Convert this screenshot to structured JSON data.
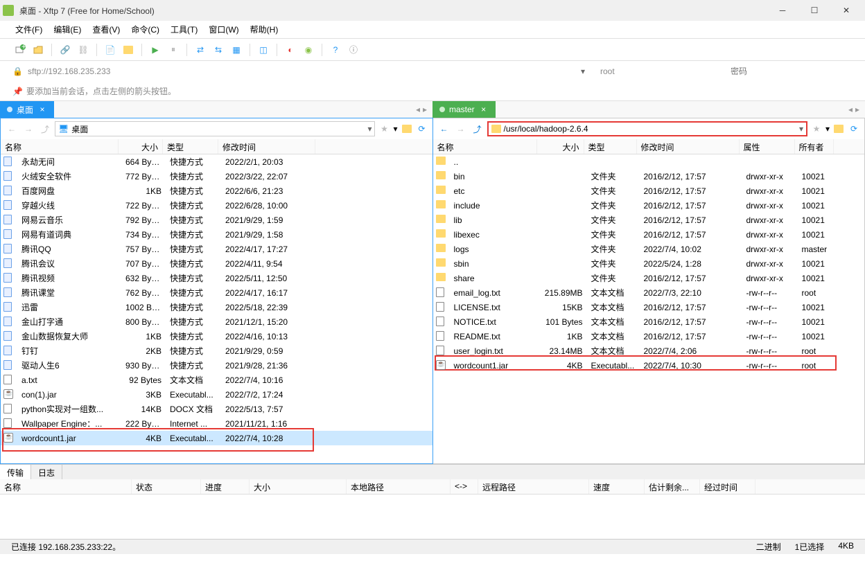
{
  "window": {
    "title": "桌面 - Xftp 7 (Free for Home/School)"
  },
  "menu": {
    "file": "文件(F)",
    "edit": "编辑(E)",
    "view": "查看(V)",
    "cmd": "命令(C)",
    "tool": "工具(T)",
    "window": "窗口(W)",
    "help": "帮助(H)"
  },
  "address": {
    "url": "sftp://192.168.235.233",
    "user": "root",
    "pass_placeholder": "密码"
  },
  "hint": "要添加当前会话，点击左侧的箭头按钮。",
  "leftTab": {
    "title": "桌面"
  },
  "rightTab": {
    "title": "master"
  },
  "leftPath": {
    "label": "桌面"
  },
  "rightPath": {
    "value": "/usr/local/hadoop-2.6.4"
  },
  "leftCols": {
    "name": "名称",
    "size": "大小",
    "type": "类型",
    "time": "修改时间"
  },
  "rightCols": {
    "name": "名称",
    "size": "大小",
    "type": "类型",
    "time": "修改时间",
    "attr": "属性",
    "owner": "所有者"
  },
  "leftFiles": [
    {
      "name": "永劫无间",
      "size": "664 Bytes",
      "type": "快捷方式",
      "time": "2022/2/1, 20:03",
      "icon": "app"
    },
    {
      "name": "火绒安全软件",
      "size": "772 Bytes",
      "type": "快捷方式",
      "time": "2022/3/22, 22:07",
      "icon": "app"
    },
    {
      "name": "百度网盘",
      "size": "1KB",
      "type": "快捷方式",
      "time": "2022/6/6, 21:23",
      "icon": "app"
    },
    {
      "name": "穿越火线",
      "size": "722 Bytes",
      "type": "快捷方式",
      "time": "2022/6/28, 10:00",
      "icon": "app"
    },
    {
      "name": "网易云音乐",
      "size": "792 Bytes",
      "type": "快捷方式",
      "time": "2021/9/29, 1:59",
      "icon": "app"
    },
    {
      "name": "网易有道词典",
      "size": "734 Bytes",
      "type": "快捷方式",
      "time": "2021/9/29, 1:58",
      "icon": "app"
    },
    {
      "name": "腾讯QQ",
      "size": "757 Bytes",
      "type": "快捷方式",
      "time": "2022/4/17, 17:27",
      "icon": "app"
    },
    {
      "name": "腾讯会议",
      "size": "707 Bytes",
      "type": "快捷方式",
      "time": "2022/4/11, 9:54",
      "icon": "app"
    },
    {
      "name": "腾讯视频",
      "size": "632 Bytes",
      "type": "快捷方式",
      "time": "2022/5/11, 12:50",
      "icon": "app"
    },
    {
      "name": "腾讯课堂",
      "size": "762 Bytes",
      "type": "快捷方式",
      "time": "2022/4/17, 16:17",
      "icon": "app"
    },
    {
      "name": "迅雷",
      "size": "1002 Byt...",
      "type": "快捷方式",
      "time": "2022/5/18, 22:39",
      "icon": "app"
    },
    {
      "name": "金山打字通",
      "size": "800 Bytes",
      "type": "快捷方式",
      "time": "2021/12/1, 15:20",
      "icon": "app"
    },
    {
      "name": "金山数据恢复大师",
      "size": "1KB",
      "type": "快捷方式",
      "time": "2022/4/16, 10:13",
      "icon": "app"
    },
    {
      "name": "钉钉",
      "size": "2KB",
      "type": "快捷方式",
      "time": "2021/9/29, 0:59",
      "icon": "app"
    },
    {
      "name": "驱动人生6",
      "size": "930 Bytes",
      "type": "快捷方式",
      "time": "2021/9/28, 21:36",
      "icon": "app"
    },
    {
      "name": "a.txt",
      "size": "92 Bytes",
      "type": "文本文档",
      "time": "2022/7/4, 10:16",
      "icon": "txt"
    },
    {
      "name": "con(1).jar",
      "size": "3KB",
      "type": "Executabl...",
      "time": "2022/7/2, 17:24",
      "icon": "jar"
    },
    {
      "name": "python实现对一组数...",
      "size": "14KB",
      "type": "DOCX 文档",
      "time": "2022/5/13, 7:57",
      "icon": "docx"
    },
    {
      "name": "Wallpaper Engine：...",
      "size": "222 Bytes",
      "type": "Internet ...",
      "time": "2021/11/21, 1:16",
      "icon": "url"
    },
    {
      "name": "wordcount1.jar",
      "size": "4KB",
      "type": "Executabl...",
      "time": "2022/7/4, 10:28",
      "icon": "jar",
      "selected": true
    }
  ],
  "rightFiles": [
    {
      "name": "..",
      "size": "",
      "type": "",
      "time": "",
      "attr": "",
      "owner": "",
      "icon": "folder"
    },
    {
      "name": "bin",
      "size": "",
      "type": "文件夹",
      "time": "2016/2/12, 17:57",
      "attr": "drwxr-xr-x",
      "owner": "10021",
      "icon": "folder"
    },
    {
      "name": "etc",
      "size": "",
      "type": "文件夹",
      "time": "2016/2/12, 17:57",
      "attr": "drwxr-xr-x",
      "owner": "10021",
      "icon": "folder"
    },
    {
      "name": "include",
      "size": "",
      "type": "文件夹",
      "time": "2016/2/12, 17:57",
      "attr": "drwxr-xr-x",
      "owner": "10021",
      "icon": "folder"
    },
    {
      "name": "lib",
      "size": "",
      "type": "文件夹",
      "time": "2016/2/12, 17:57",
      "attr": "drwxr-xr-x",
      "owner": "10021",
      "icon": "folder"
    },
    {
      "name": "libexec",
      "size": "",
      "type": "文件夹",
      "time": "2016/2/12, 17:57",
      "attr": "drwxr-xr-x",
      "owner": "10021",
      "icon": "folder"
    },
    {
      "name": "logs",
      "size": "",
      "type": "文件夹",
      "time": "2022/7/4, 10:02",
      "attr": "drwxr-xr-x",
      "owner": "master",
      "icon": "folder"
    },
    {
      "name": "sbin",
      "size": "",
      "type": "文件夹",
      "time": "2022/5/24, 1:28",
      "attr": "drwxr-xr-x",
      "owner": "10021",
      "icon": "folder"
    },
    {
      "name": "share",
      "size": "",
      "type": "文件夹",
      "time": "2016/2/12, 17:57",
      "attr": "drwxr-xr-x",
      "owner": "10021",
      "icon": "folder"
    },
    {
      "name": "email_log.txt",
      "size": "215.89MB",
      "type": "文本文档",
      "time": "2022/7/3, 22:10",
      "attr": "-rw-r--r--",
      "owner": "root",
      "icon": "txt"
    },
    {
      "name": "LICENSE.txt",
      "size": "15KB",
      "type": "文本文档",
      "time": "2016/2/12, 17:57",
      "attr": "-rw-r--r--",
      "owner": "10021",
      "icon": "txt"
    },
    {
      "name": "NOTICE.txt",
      "size": "101 Bytes",
      "type": "文本文档",
      "time": "2016/2/12, 17:57",
      "attr": "-rw-r--r--",
      "owner": "10021",
      "icon": "txt"
    },
    {
      "name": "README.txt",
      "size": "1KB",
      "type": "文本文档",
      "time": "2016/2/12, 17:57",
      "attr": "-rw-r--r--",
      "owner": "10021",
      "icon": "txt"
    },
    {
      "name": "user_login.txt",
      "size": "23.14MB",
      "type": "文本文档",
      "time": "2022/7/4, 2:06",
      "attr": "-rw-r--r--",
      "owner": "root",
      "icon": "txt"
    },
    {
      "name": "wordcount1.jar",
      "size": "4KB",
      "type": "Executabl...",
      "time": "2022/7/4, 10:30",
      "attr": "-rw-r--r--",
      "owner": "root",
      "icon": "jar"
    }
  ],
  "bottomTabs": {
    "transfer": "传输",
    "log": "日志"
  },
  "transferCols": {
    "name": "名称",
    "status": "状态",
    "progress": "进度",
    "size": "大小",
    "local": "本地路径",
    "arrow": "<->",
    "remote": "远程路径",
    "speed": "速度",
    "est": "估计剩余...",
    "elapsed": "经过时间"
  },
  "status": {
    "conn": "已连接 192.168.235.233:22。",
    "binary": "二进制",
    "selected": "1已选择",
    "size": "4KB"
  }
}
